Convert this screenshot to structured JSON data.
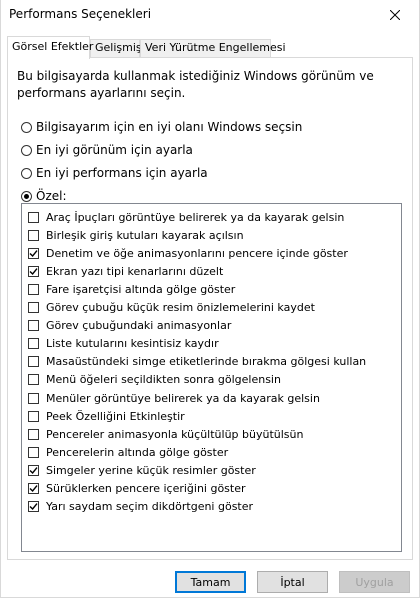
{
  "window": {
    "title": "Performans Seçenekleri"
  },
  "tabs": [
    {
      "label": "Görsel Efektler",
      "active": true
    },
    {
      "label": "Gelişmiş",
      "active": false
    },
    {
      "label": "Veri Yürütme Engellemesi",
      "active": false
    }
  ],
  "description": "Bu bilgisayarda kullanmak istediğiniz Windows görünüm ve performans ayarlarını seçin.",
  "radio_options": [
    {
      "label": "Bilgisayarım için en iyi olanı Windows seçsin",
      "selected": false
    },
    {
      "label": "En iyi görünüm için ayarla",
      "selected": false
    },
    {
      "label": "En iyi performans için ayarla",
      "selected": false
    },
    {
      "label": "Özel:",
      "selected": true
    }
  ],
  "effects": [
    {
      "label": "Araç İpuçları görüntüye belirerek ya da kayarak gelsin",
      "checked": false
    },
    {
      "label": "Birleşik giriş kutuları kayarak açılsın",
      "checked": false
    },
    {
      "label": "Denetim ve öğe animasyonlarını pencere içinde göster",
      "checked": true
    },
    {
      "label": "Ekran yazı tipi kenarlarını düzelt",
      "checked": true
    },
    {
      "label": "Fare işaretçisi altında gölge göster",
      "checked": false
    },
    {
      "label": "Görev çubuğu küçük resim önizlemelerini kaydet",
      "checked": false
    },
    {
      "label": "Görev çubuğundaki animasyonlar",
      "checked": false
    },
    {
      "label": "Liste kutularını kesintisiz kaydır",
      "checked": false
    },
    {
      "label": "Masaüstündeki simge etiketlerinde bırakma gölgesi kullan",
      "checked": false
    },
    {
      "label": "Menü öğeleri seçildikten sonra gölgelensin",
      "checked": false
    },
    {
      "label": "Menüler görüntüye belirerek ya da kayarak gelsin",
      "checked": false
    },
    {
      "label": "Peek Özelliğini Etkinleştir",
      "checked": false
    },
    {
      "label": "Pencereler animasyonla küçültülüp büyütülsün",
      "checked": false
    },
    {
      "label": "Pencerelerin altında gölge göster",
      "checked": false
    },
    {
      "label": "Simgeler yerine küçük resimler göster",
      "checked": true
    },
    {
      "label": "Sürüklerken pencere içeriğini göster",
      "checked": true
    },
    {
      "label": "Yarı saydam seçim dikdörtgeni göster",
      "checked": true
    }
  ],
  "buttons": {
    "ok": "Tamam",
    "cancel": "İptal",
    "apply": "Uygula"
  },
  "colors": {
    "accent": "#0078d7",
    "border": "#d9d9d9",
    "list_border": "#828790",
    "button_face": "#e1e1e1",
    "disabled_text": "#a0a0a0"
  }
}
